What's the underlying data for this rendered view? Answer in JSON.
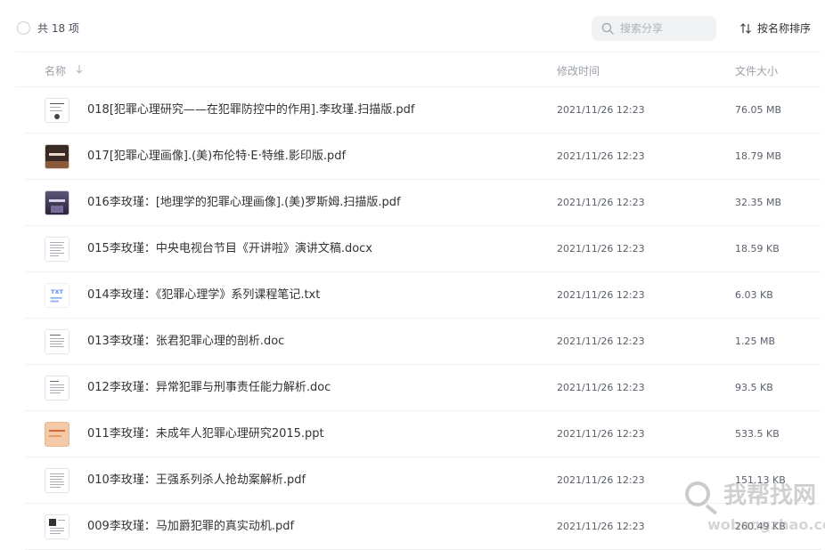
{
  "toolbar": {
    "count_label": "共 18 项",
    "search_placeholder": "搜索分享",
    "sort_label": "按名称排序"
  },
  "columns": {
    "name": "名称",
    "time": "修改时间",
    "size": "文件大小"
  },
  "files": [
    {
      "name": "018[犯罪心理研究——在犯罪防控中的作用].李玫瑾.扫描版.pdf",
      "time": "2021/11/26 12:23",
      "size": "76.05 MB",
      "thumb": "pdf-cover-icon"
    },
    {
      "name": "017[犯罪心理画像].(美)布伦特·E·特维.影印版.pdf",
      "time": "2021/11/26 12:23",
      "size": "18.79 MB",
      "thumb": "pdf-cover-icon"
    },
    {
      "name": "016李玫瑾：[地理学的犯罪心理画像].(美)罗斯姆.扫描版.pdf",
      "time": "2021/11/26 12:23",
      "size": "32.35 MB",
      "thumb": "pdf-cover-icon"
    },
    {
      "name": "015李玫瑾：中央电视台节目《开讲啦》演讲文稿.docx",
      "time": "2021/11/26 12:23",
      "size": "18.59 KB",
      "thumb": "doc-file-icon"
    },
    {
      "name": "014李玫瑾：《犯罪心理学》系列课程笔记.txt",
      "time": "2021/11/26 12:23",
      "size": "6.03 KB",
      "thumb": "txt-file-icon"
    },
    {
      "name": "013李玫瑾：张君犯罪心理的剖析.doc",
      "time": "2021/11/26 12:23",
      "size": "1.25 MB",
      "thumb": "doc-file-icon"
    },
    {
      "name": "012李玫瑾：异常犯罪与刑事责任能力解析.doc",
      "time": "2021/11/26 12:23",
      "size": "93.5 KB",
      "thumb": "doc-file-icon"
    },
    {
      "name": "011李玫瑾：未成年人犯罪心理研究2015.ppt",
      "time": "2021/11/26 12:23",
      "size": "533.5 KB",
      "thumb": "ppt-file-icon"
    },
    {
      "name": "010李玫瑾：王强系列杀人抢劫案解析.pdf",
      "time": "2021/11/26 12:23",
      "size": "151.13 KB",
      "thumb": "doc-file-icon"
    },
    {
      "name": "009李玫瑾：马加爵犯罪的真实动机.pdf",
      "time": "2021/11/26 12:23",
      "size": "260.49 KB",
      "thumb": "doc-file-icon"
    }
  ],
  "watermark": {
    "text": "我帮找网",
    "url": "wobangzhao.com"
  },
  "colors": {
    "accent": "#06a7ff",
    "text": "#333333",
    "muted": "#9ba0a9",
    "divider": "#f0f1f3"
  }
}
